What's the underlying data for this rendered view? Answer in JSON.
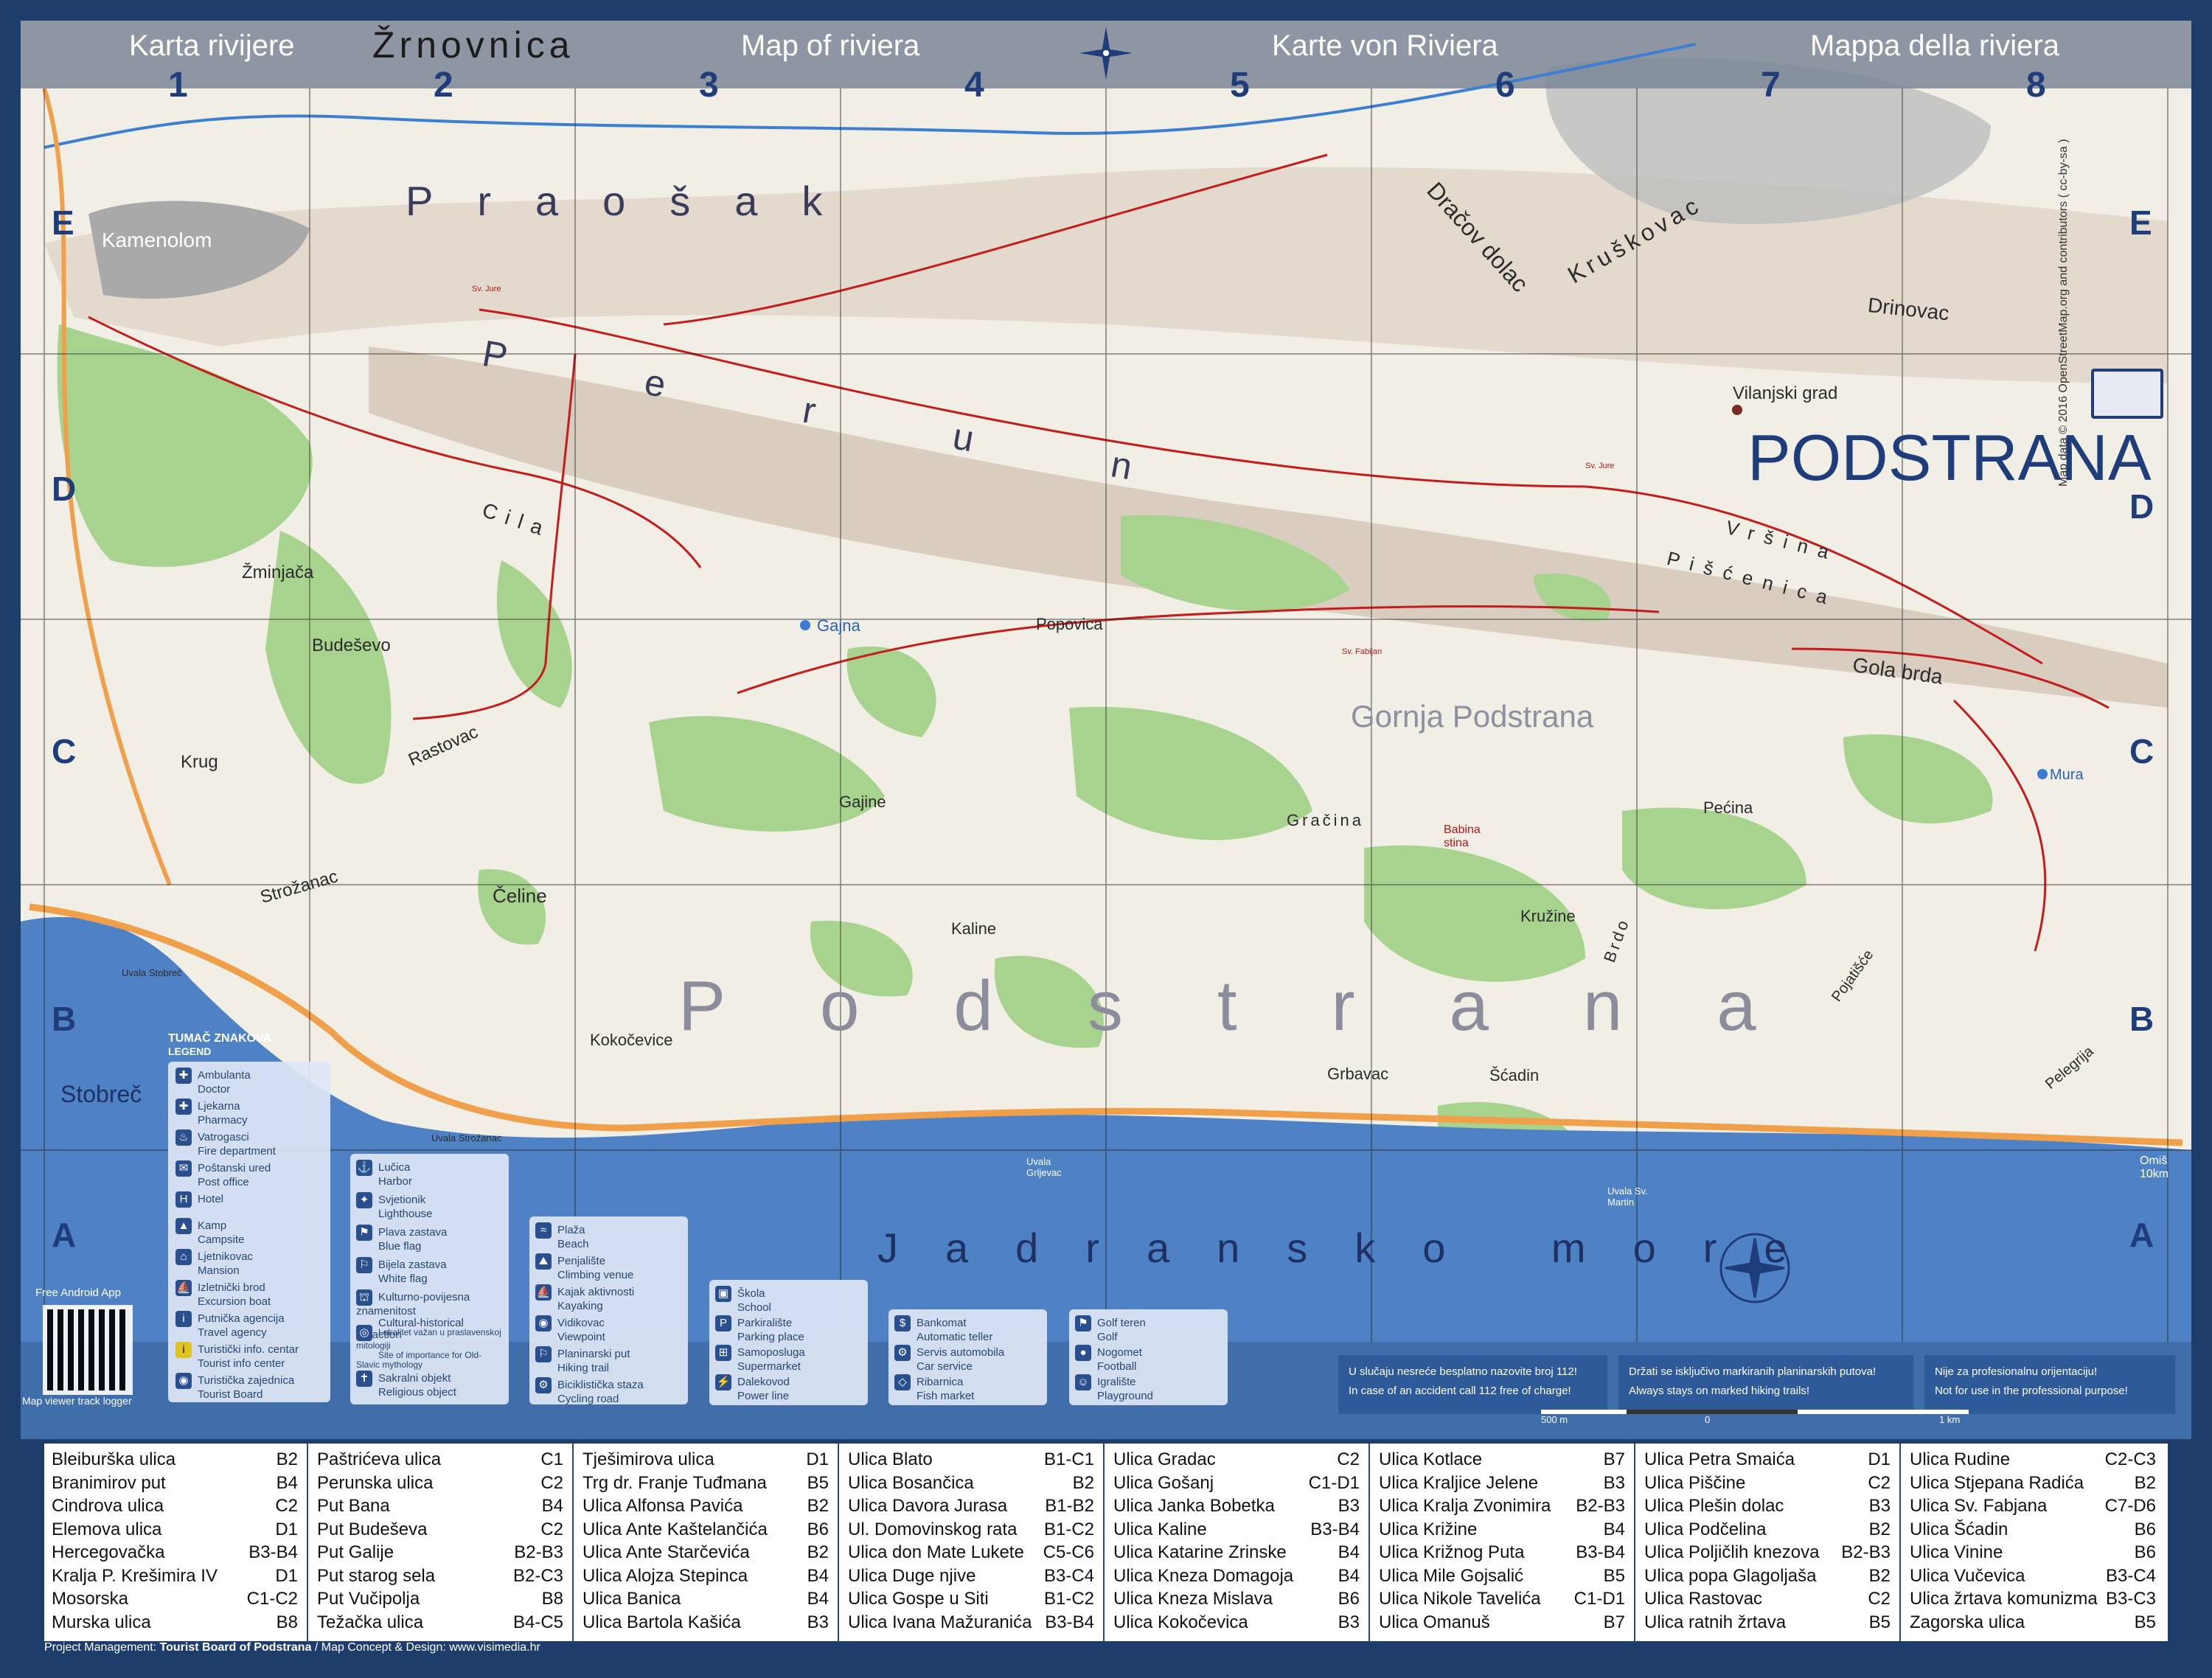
{
  "header": {
    "titles": [
      "Karta rivijere",
      "Map of riviera",
      "Karte von Riviera",
      "Mappa della riviera"
    ],
    "columns": [
      "1",
      "2",
      "3",
      "4",
      "5",
      "6",
      "7",
      "8"
    ],
    "rows": [
      "E",
      "D",
      "C",
      "B",
      "A"
    ]
  },
  "logo": {
    "text": "PODSTRANA"
  },
  "copyright": "Map data © 2016 OpenStreetMap.org and contributors ( cc-by-sa )",
  "places": {
    "zrnovnica": "Žrnovnica",
    "kamenolom": "Kamenolom",
    "draco_dolac": "Dračov dolac",
    "kruskovac": "Kruškovac",
    "drinovac": "Drinovac",
    "vilanjski": "Vilanjski grad",
    "zminjaca": "Žminjača",
    "budesevo": "Budeševo",
    "krug": "Krug",
    "rastovac": "Rastovac",
    "celine": "Čeline",
    "strozanac": "Strožanac",
    "stobrec": "Stobreč",
    "gajna": "Gajna",
    "popovica": "Popovica",
    "gajine": "Gajine",
    "kaline": "Kaline",
    "kokocevice": "Kokočevice",
    "gracina": "Gračina",
    "babina": "Babina stina",
    "grbavac": "Grbavac",
    "scadin": "Šćadin",
    "kruzine": "Kružine",
    "brdo": "Brdo",
    "pecina": "Pećina",
    "pojatisce": "Pojatišće",
    "pelegrija": "Pelegrija",
    "mura": "Mura",
    "gola_brda": "Gola brda",
    "vrsina": "Vršina",
    "piscenica": "Pišćenica",
    "gornja": "Gornja Podstrana",
    "uvala_stobrec": "Uvala Stobreč",
    "uvala_strozanac": "Uvala Strožanac",
    "uvala_grljevac": "Uvala Grljevac",
    "uvala_sv_martin": "Uvala Sv. Martin",
    "omis": "Omiš 10km",
    "cila": "Cila",
    "sv_jure_1": "Sv. Jure",
    "sv_jure_2": "Sv. Jure",
    "sv_fabijan": "Sv. Fabijan",
    "perunika": "Perun"
  },
  "big_labels": {
    "praosak": "Praošak",
    "perun": "Perun",
    "podstrana": "Podstrana",
    "jadransko": "Jadransko more"
  },
  "legend": {
    "title": "TUMAČ ZNAKOVA",
    "subtitle": "LEGEND",
    "col1": [
      {
        "hr": "Ambulanta",
        "en": "Doctor",
        "icon": "✚"
      },
      {
        "hr": "Ljekarna",
        "en": "Pharmacy",
        "icon": "✚"
      },
      {
        "hr": "Vatrogasci",
        "en": "Fire department",
        "icon": "♨"
      },
      {
        "hr": "Poštanski ured",
        "en": "Post office",
        "icon": "✉"
      },
      {
        "hr": "Hotel",
        "en": "",
        "icon": "H"
      },
      {
        "hr": "Kamp",
        "en": "Campsite",
        "icon": "▲"
      },
      {
        "hr": "Ljetnikovac",
        "en": "Mansion",
        "icon": "⌂"
      },
      {
        "hr": "Izletnički brod",
        "en": "Excursion boat",
        "icon": "⛵"
      },
      {
        "hr": "Putnička agencija",
        "en": "Travel agency",
        "icon": "i"
      },
      {
        "hr": "Turistički info. centar",
        "en": "Tourist info center",
        "icon": "i"
      },
      {
        "hr": "Turistička zajednica",
        "en": "Tourist Board",
        "icon": "◉"
      }
    ],
    "col2": [
      {
        "hr": "Lučica",
        "en": "Harbor",
        "icon": "⚓"
      },
      {
        "hr": "Svjetionik",
        "en": "Lighthouse",
        "icon": "✦"
      },
      {
        "hr": "Plava zastava",
        "en": "Blue flag",
        "icon": "⚑"
      },
      {
        "hr": "Bijela zastava",
        "en": "White flag",
        "icon": "⚐"
      },
      {
        "hr": "Kulturno-povijesna znamenitost",
        "en": "Cultural-historical attraction",
        "icon": "⛫"
      },
      {
        "hr": "Lokalitet važan u praslavenskoj mitologiji",
        "en": "Site of importance for Old-Slavic mythology",
        "icon": "◎"
      },
      {
        "hr": "Sakralni objekt",
        "en": "Religious object",
        "icon": "✝"
      }
    ],
    "col3": [
      {
        "hr": "Plaža",
        "en": "Beach",
        "icon": "≈"
      },
      {
        "hr": "Penjalište",
        "en": "Climbing venue",
        "icon": "⛰"
      },
      {
        "hr": "Kajak aktivnosti",
        "en": "Kayaking",
        "icon": "⛵"
      },
      {
        "hr": "Vidikovac",
        "en": "Viewpoint",
        "icon": "◉"
      },
      {
        "hr": "Planinarski put",
        "en": "Hiking trail",
        "icon": "⚐"
      },
      {
        "hr": "Biciklistička staza",
        "en": "Cycling road",
        "icon": "⚙"
      }
    ],
    "col4": [
      {
        "hr": "Škola",
        "en": "School",
        "icon": "▣"
      },
      {
        "hr": "Parkiralište",
        "en": "Parking place",
        "icon": "P"
      },
      {
        "hr": "Samoposluga",
        "en": "Supermarket",
        "icon": "⊞"
      },
      {
        "hr": "Dalekovod",
        "en": "Power line",
        "icon": "⚡"
      }
    ],
    "col5": [
      {
        "hr": "Bankomat",
        "en": "Automatic teller",
        "icon": "$"
      },
      {
        "hr": "Servis automobila",
        "en": "Car service",
        "icon": "⚙"
      },
      {
        "hr": "Ribarnica",
        "en": "Fish market",
        "icon": "◇"
      }
    ],
    "col6": [
      {
        "hr": "Golf teren",
        "en": "Golf",
        "icon": "⚑"
      },
      {
        "hr": "Nogomet",
        "en": "Football",
        "icon": "●"
      },
      {
        "hr": "Igralište",
        "en": "Playground",
        "icon": "☺"
      }
    ]
  },
  "app": {
    "label": "Free Android App",
    "caption": "Map viewer track logger"
  },
  "notices": [
    {
      "hr": "U slučaju nesreće besplatno nazovite broj 112!",
      "en": "In case of an accident call 112 free of charge!"
    },
    {
      "hr": "Držati se isključivo markiranih planinarskih putova!",
      "en": "Always stays on marked hiking trails!"
    },
    {
      "hr": "Nije za profesionalnu orijentaciju!",
      "en": "Not for use in the professional purpose!"
    }
  ],
  "scale": {
    "left": "500 m",
    "mid": "0",
    "right": "1 km"
  },
  "streets": [
    [
      [
        "Bleiburška ulica",
        "B2"
      ],
      [
        "Branimirov put",
        "B4"
      ],
      [
        "Cindrova ulica",
        "C2"
      ],
      [
        "Elemova ulica",
        "D1"
      ],
      [
        "Hercegovačka",
        "B3-B4"
      ],
      [
        "Kralja P. Krešimira IV",
        "D1"
      ],
      [
        "Mosorska",
        "C1-C2"
      ],
      [
        "Murska ulica",
        "B8"
      ]
    ],
    [
      [
        "Paštrićeva ulica",
        "C1"
      ],
      [
        "Perunska ulica",
        "C2"
      ],
      [
        "Put Bana",
        "B4"
      ],
      [
        "Put Budeševa",
        "C2"
      ],
      [
        "Put Galije",
        "B2-B3"
      ],
      [
        "Put starog sela",
        "B2-C3"
      ],
      [
        "Put Vučipolja",
        "B8"
      ],
      [
        "Težačka ulica",
        "B4-C5"
      ]
    ],
    [
      [
        "Tješimirova ulica",
        "D1"
      ],
      [
        "Trg dr. Franje Tuđmana",
        "B5"
      ],
      [
        "Ulica Alfonsa Pavića",
        "B2"
      ],
      [
        "Ulica Ante Kaštelančića",
        "B6"
      ],
      [
        "Ulica Ante Starčevića",
        "B2"
      ],
      [
        "Ulica Alojza Stepinca",
        "B4"
      ],
      [
        "Ulica Banica",
        "B4"
      ],
      [
        "Ulica Bartola Kašića",
        "B3"
      ]
    ],
    [
      [
        "Ulica Blato",
        "B1-C1"
      ],
      [
        "Ulica Bosančica",
        "B2"
      ],
      [
        "Ulica Davora Jurasa",
        "B1-B2"
      ],
      [
        "Ul. Domovinskog rata",
        "B1-C2"
      ],
      [
        "Ulica don Mate Lukete",
        "C5-C6"
      ],
      [
        "Ulica Duge njive",
        "B3-C4"
      ],
      [
        "Ulica Gospe u Siti",
        "B1-C2"
      ],
      [
        "Ulica Ivana Mažuranića",
        "B3-B4"
      ]
    ],
    [
      [
        "Ulica Gradac",
        "C2"
      ],
      [
        "Ulica Gošanj",
        "C1-D1"
      ],
      [
        "Ulica Janka Bobetka",
        "B3"
      ],
      [
        "Ulica Kaline",
        "B3-B4"
      ],
      [
        "Ulica Katarine Zrinske",
        "B4"
      ],
      [
        "Ulica Kneza Domagoja",
        "B4"
      ],
      [
        "Ulica Kneza Mislava",
        "B6"
      ],
      [
        "Ulica Kokočevica",
        "B3"
      ]
    ],
    [
      [
        "Ulica Kotlace",
        "B7"
      ],
      [
        "Ulica Kraljice Jelene",
        "B3"
      ],
      [
        "Ulica Kralja Zvonimira",
        "B2-B3"
      ],
      [
        "Ulica Križine",
        "B4"
      ],
      [
        "Ulica Križnog Puta",
        "B3-B4"
      ],
      [
        "Ulica Mile Gojsalić",
        "B5"
      ],
      [
        "Ulica Nikole Tavelića",
        "C1-D1"
      ],
      [
        "Ulica Omanuš",
        "B7"
      ]
    ],
    [
      [
        "Ulica Petra Smaića",
        "D1"
      ],
      [
        "Ulica Piščine",
        "C2"
      ],
      [
        "Ulica Plešin dolac",
        "B3"
      ],
      [
        "Ulica Podčelina",
        "B2"
      ],
      [
        "Ulica Poljičlih knezova",
        "B2-B3"
      ],
      [
        "Ulica popa Glagoljaša",
        "B2"
      ],
      [
        "Ulica Rastovac",
        "C2"
      ],
      [
        "Ulica ratnih žrtava",
        "B5"
      ]
    ],
    [
      [
        "Ulica Rudine",
        "C2-C3"
      ],
      [
        "Ulica Stjepana Radića",
        "B2"
      ],
      [
        "Ulica Sv. Fabjana",
        "C7-D6"
      ],
      [
        "Ulica Šćadin",
        "B6"
      ],
      [
        "Ulica Vinine",
        "B6"
      ],
      [
        "Ulica Vučevica",
        "B3-C4"
      ],
      [
        "Ulica žrtava komunizma",
        "B3-C3"
      ],
      [
        "Zagorska ulica",
        "B5"
      ]
    ]
  ],
  "footer": {
    "prefix": "Project Management: ",
    "org": "Tourist Board of Podstrana",
    "sep": " / Map Concept & Design: ",
    "design": "www.visimedia.hr"
  },
  "colors": {
    "sea": "#4f82c4",
    "land": "#f1eee6",
    "forest": "#a7d38e",
    "ridge": "#d8cdbf",
    "trail": "#c41b1b",
    "road": "#f0a04a",
    "border": "#1f3d6b"
  }
}
